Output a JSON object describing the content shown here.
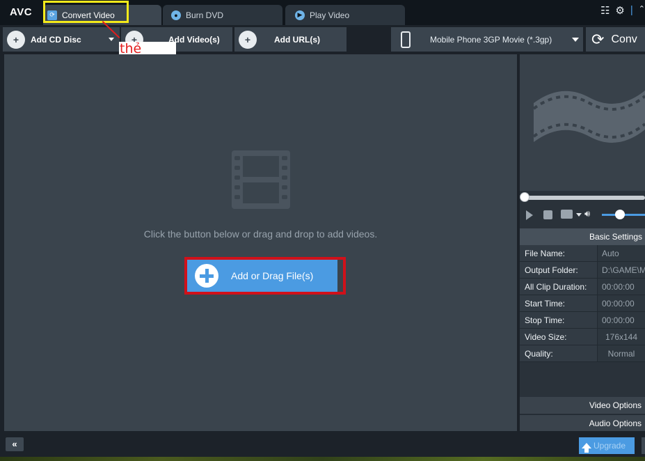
{
  "app": {
    "logo": "AVC"
  },
  "tabs": [
    {
      "label": "Convert Video",
      "icon": "refresh-icon",
      "active": true
    },
    {
      "label": "Burn DVD",
      "icon": "disc-icon",
      "active": false
    },
    {
      "label": "Play Video",
      "icon": "play-circle-icon",
      "active": false
    }
  ],
  "toolbar": {
    "add_cd": "Add CD Disc",
    "add_video": "Add Video(s)",
    "add_url": "Add URL(s)",
    "profile": "Mobile Phone 3GP Movie (*.3gp)",
    "convert": "Conv"
  },
  "annotation": {
    "text": "thẻ",
    "color": "#e31d1d",
    "highlight_color": "#f4ea1a"
  },
  "main": {
    "hint": "Click the button below or drag and drop to add videos.",
    "add_button": "Add or Drag File(s)"
  },
  "player": {
    "volume_level": 0.55
  },
  "settings": {
    "header": "Basic Settings",
    "rows": [
      {
        "key": "File Name:",
        "value": "Auto"
      },
      {
        "key": "Output Folder:",
        "value": "D:\\GAME\\MO"
      },
      {
        "key": "All Clip Duration:",
        "value": "00:00:00"
      },
      {
        "key": "Start Time:",
        "value": "00:00:00"
      },
      {
        "key": "Stop Time:",
        "value": "00:00:00"
      },
      {
        "key": "Video Size:",
        "value": "176x144"
      },
      {
        "key": "Quality:",
        "value": "Normal"
      }
    ],
    "video_options": "Video Options",
    "audio_options": "Audio Options"
  },
  "footer": {
    "collapse": "«",
    "upgrade": "Upgrade"
  },
  "colors": {
    "accent": "#4b9be2",
    "panel": "#3a444d",
    "frame_red": "#d0111a"
  }
}
